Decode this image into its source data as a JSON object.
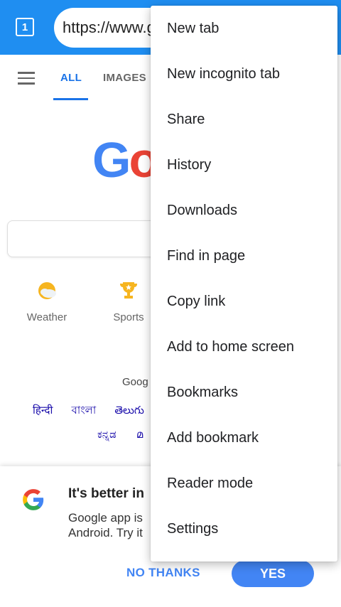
{
  "toolbar": {
    "tab_count": "1",
    "url": "https://www.google.com"
  },
  "nav": {
    "tabs": [
      {
        "label": "ALL",
        "active": true
      },
      {
        "label": "IMAGES",
        "active": false
      }
    ]
  },
  "logo_text": "Go",
  "quick_links": [
    {
      "label": "Weather",
      "icon": "weather-icon"
    },
    {
      "label": "Sports",
      "icon": "trophy-icon"
    }
  ],
  "offered_in": "Goog",
  "languages_row1": [
    "हिन्दी",
    "বাংলা",
    "తెలుగు"
  ],
  "languages_row2": [
    "ಕನ್ನಡ",
    "മ"
  ],
  "promo": {
    "title": "It's better in",
    "body_line1": "Google app is",
    "body_line2": "Android. Try it",
    "no_thanks": "NO THANKS",
    "yes": "YES"
  },
  "menu": {
    "items": [
      "New tab",
      "New incognito tab",
      "Share",
      "History",
      "Downloads",
      "Find in page",
      "Copy link",
      "Add to home screen",
      "Bookmarks",
      "Add bookmark",
      "Reader mode",
      "Settings"
    ]
  },
  "colors": {
    "toolbar_blue": "#1f8ef1",
    "google_blue": "#4285f4",
    "google_red": "#ea4335"
  }
}
